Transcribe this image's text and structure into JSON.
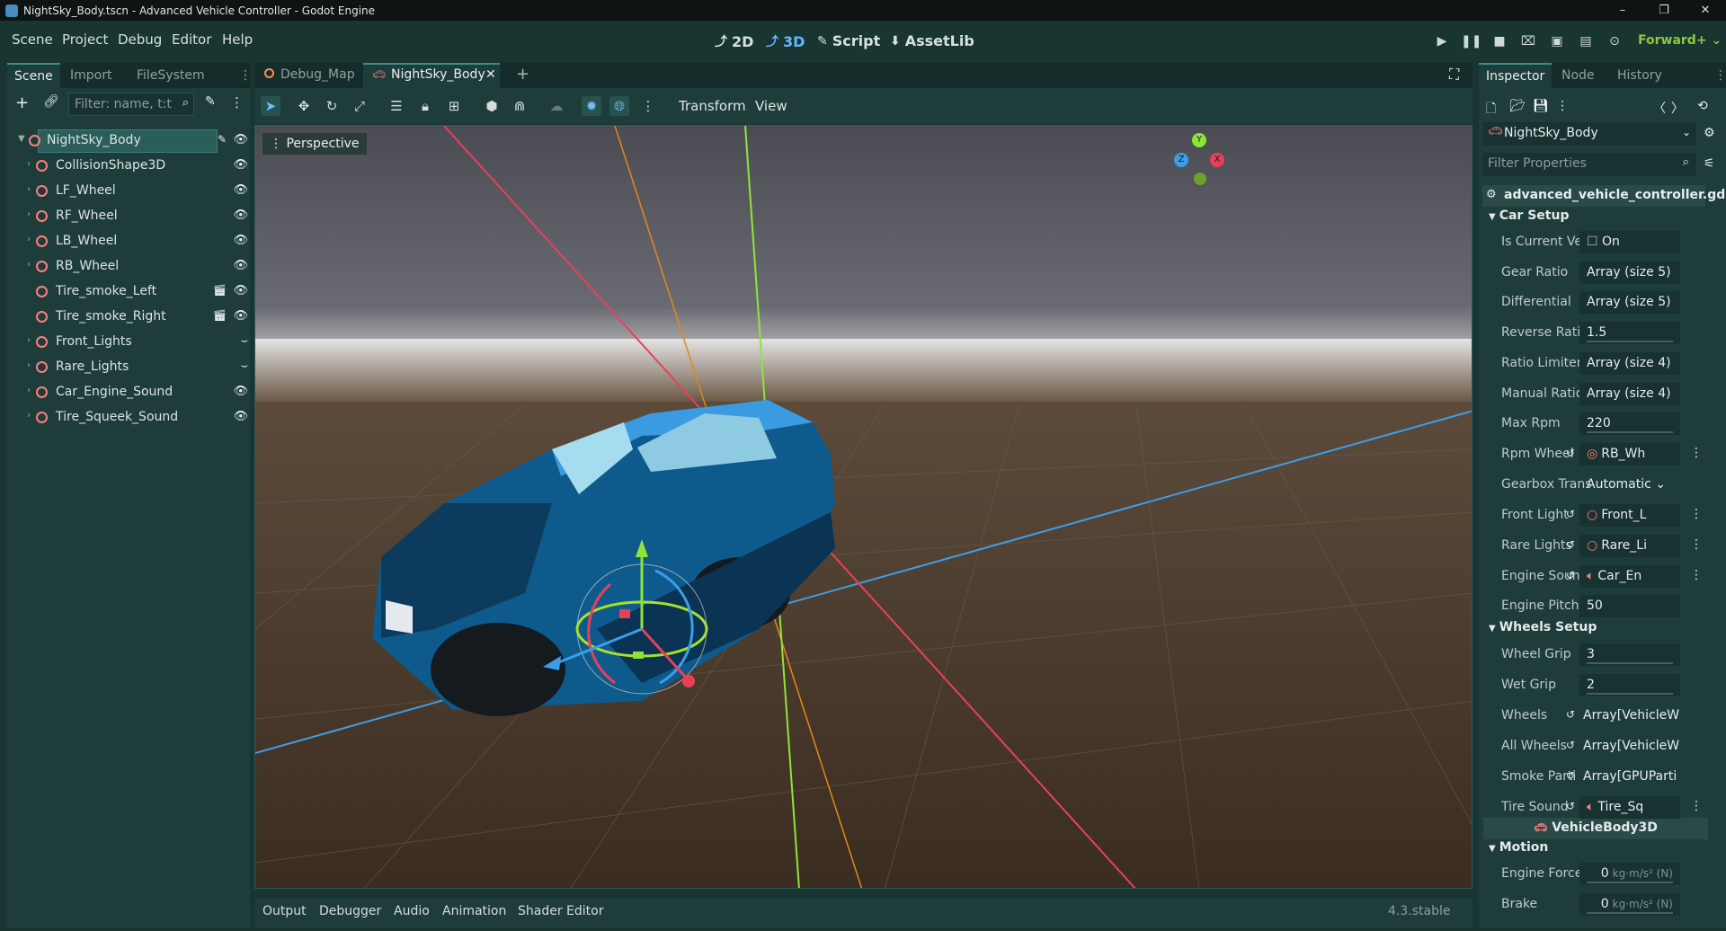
{
  "window": {
    "title": "NightSky_Body.tscn - Advanced Vehicle Controller - Godot Engine",
    "controls": [
      "–",
      "❐",
      "✕"
    ]
  },
  "menu": [
    "Scene",
    "Project",
    "Debug",
    "Editor",
    "Help"
  ],
  "main_screens": [
    {
      "label": "2D",
      "icon": "2d-icon"
    },
    {
      "label": "3D",
      "icon": "3d-icon"
    },
    {
      "label": "Script",
      "icon": "script-icon"
    },
    {
      "label": "AssetLib",
      "icon": "assetlib-icon"
    }
  ],
  "renderer": "Forward+",
  "scene_dock": {
    "tabs": [
      "Scene",
      "Import",
      "FileSystem"
    ],
    "filter_placeholder": "Filter: name, t:t",
    "nodes": [
      {
        "name": "NightSky_Body",
        "color": "#fc7f7f",
        "root": true
      },
      {
        "name": "CollisionShape3D",
        "color": "#fc7f7f"
      },
      {
        "name": "LF_Wheel",
        "color": "#fc7f7f"
      },
      {
        "name": "RF_Wheel",
        "color": "#fc7f7f"
      },
      {
        "name": "LB_Wheel",
        "color": "#fc7f7f"
      },
      {
        "name": "RB_Wheel",
        "color": "#fc7f7f"
      },
      {
        "name": "Tire_smoke_Left",
        "color": "#fc7f7f"
      },
      {
        "name": "Tire_smoke_Right",
        "color": "#fc7f7f"
      },
      {
        "name": "Front_Lights",
        "color": "#fc7f7f"
      },
      {
        "name": "Rare_Lights",
        "color": "#fc7f7f"
      },
      {
        "name": "Car_Engine_Sound",
        "color": "#fc7f7f"
      },
      {
        "name": "Tire_Squeek_Sound",
        "color": "#fc7f7f"
      }
    ]
  },
  "editor_tabs": [
    "Debug_Map",
    "NightSky_Body"
  ],
  "viewport": {
    "menus": [
      "Transform",
      "View"
    ],
    "perspective_label": "Perspective",
    "gizmo_axes": [
      "Y",
      "X",
      "Z"
    ]
  },
  "bottom_tabs": [
    "Output",
    "Debugger",
    "Audio",
    "Animation",
    "Shader Editor"
  ],
  "version": "4.3.stable",
  "inspector": {
    "tabs": [
      "Inspector",
      "Node",
      "History"
    ],
    "object": "NightSky_Body",
    "filter_placeholder": "Filter Properties",
    "script": "advanced_vehicle_controller.gd",
    "sections": [
      {
        "title": "Car Setup"
      },
      {
        "title": "Wheels Setup"
      },
      {
        "title": "VehicleBody3D"
      },
      {
        "title": "Motion"
      }
    ],
    "car_setup": [
      {
        "label": "Is Current Veh",
        "value": "On"
      },
      {
        "label": "Gear Ratio",
        "value": "Array (size 5)"
      },
      {
        "label": "Differential",
        "value": "Array (size 5)"
      },
      {
        "label": "Reverse Ratio",
        "value": "1.5"
      },
      {
        "label": "Ratio Limiter",
        "value": "Array (size 4)"
      },
      {
        "label": "Manual Ratio Li",
        "value": "Array (size 4)"
      },
      {
        "label": "Max Rpm",
        "value": "220"
      },
      {
        "label": "Rpm Wheel",
        "value": "RB_Wh"
      },
      {
        "label": "Gearbox Trans",
        "value": "Automatic"
      },
      {
        "label": "Front Light",
        "value": "Front_L"
      },
      {
        "label": "Rare Lights",
        "value": "Rare_Li"
      },
      {
        "label": "Engine Soun",
        "value": "Car_En"
      },
      {
        "label": "Engine Pitch M",
        "value": "50"
      }
    ],
    "wheels_setup": [
      {
        "label": "Wheel Grip",
        "value": "3"
      },
      {
        "label": "Wet Grip",
        "value": "2"
      },
      {
        "label": "Wheels",
        "value": "Array[VehicleW"
      },
      {
        "label": "All Wheels",
        "value": "Array[VehicleW"
      },
      {
        "label": "Smoke Parti",
        "value": "Array[GPUParti"
      },
      {
        "label": "Tire Sound",
        "value": "Tire_Sq"
      }
    ],
    "motion": [
      {
        "label": "Engine Force",
        "value": "0",
        "unit": "kg·m/s² (N)"
      },
      {
        "label": "Brake",
        "value": "0",
        "unit": "kg·m/s² (N)"
      }
    ]
  }
}
